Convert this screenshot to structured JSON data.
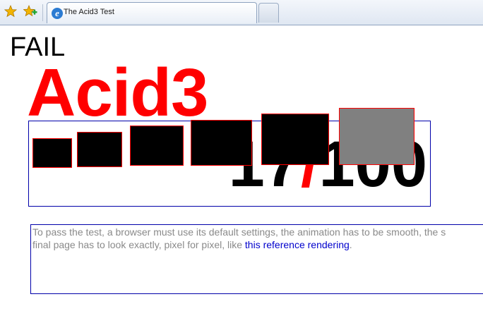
{
  "browser": {
    "tab_title": "The Acid3 Test",
    "tab_icon": "internet-explorer-icon",
    "toolbar_icons": [
      "favorites-star-icon",
      "add-favorites-icon"
    ],
    "colors": {
      "star": "#f2b400",
      "add_plus": "#22a533"
    }
  },
  "page": {
    "result": "FAIL",
    "title": "Acid3",
    "score": "17",
    "score_separator": "/",
    "score_total": "100",
    "instructions": {
      "line1": "To pass the test, a browser must use its default settings, the animation has to be smooth, the s",
      "line2_prefix": "final page has to look exactly, pixel for pixel, like ",
      "link_text": "this reference rendering",
      "line2_suffix": "."
    },
    "colors": {
      "title": "#ff0000",
      "score_separator": "#ff0000",
      "box_border": "#0000aa",
      "instructions_text": "#8a8a8a",
      "link": "#0000cc",
      "bucket_fill": "#000000",
      "bucket_incomplete_fill": "#808080",
      "bucket_border": "#ff0000"
    }
  }
}
